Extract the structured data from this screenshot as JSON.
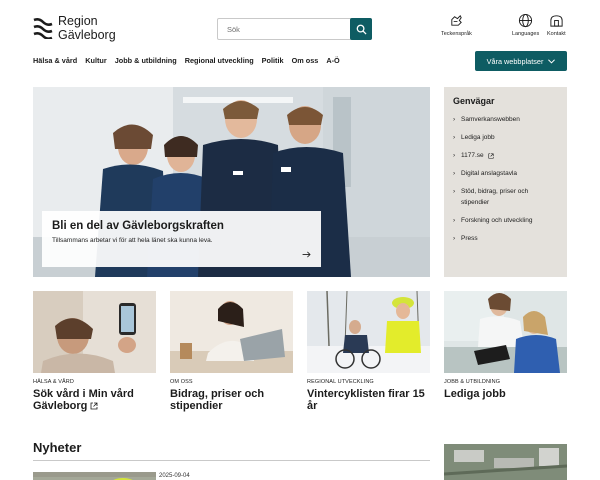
{
  "header": {
    "logo_line1": "Region",
    "logo_line2": "Gävleborg",
    "search_placeholder": "Sök",
    "utilities": [
      {
        "label": "Teckenspråk",
        "icon": "sign-language-icon"
      },
      {
        "label": "Languages",
        "icon": "globe-icon"
      },
      {
        "label": "Kontakt",
        "icon": "contact-icon"
      }
    ]
  },
  "nav": {
    "items": [
      "Hälsa & vård",
      "Kultur",
      "Jobb & utbildning",
      "Regional utveckling",
      "Politik",
      "Om oss",
      "A-Ö"
    ],
    "sites_button": "Våra webbplatser"
  },
  "hero": {
    "title": "Bli en del av Gävleborgskraften",
    "subtitle": "Tillsammans arbetar vi för att hela länet ska kunna leva."
  },
  "shortcuts": {
    "title": "Genvägar",
    "items": [
      {
        "label": "Samverkanswebben",
        "external": false
      },
      {
        "label": "Lediga jobb",
        "external": false
      },
      {
        "label": "1177.se",
        "external": true
      },
      {
        "label": "Digital anslagstavla",
        "external": false
      },
      {
        "label": "Stöd, bidrag, priser och stipendier",
        "external": false
      },
      {
        "label": "Forskning och utveckling",
        "external": false
      },
      {
        "label": "Press",
        "external": false
      }
    ]
  },
  "cards": [
    {
      "category": "HÄLSA & VÅRD",
      "title": "Sök vård i Min vård Gävleborg",
      "external": true
    },
    {
      "category": "OM OSS",
      "title": "Bidrag, priser och stipendier",
      "external": false
    },
    {
      "category": "REGIONAL UTVECKLING",
      "title": "Vintercyklisten firar 15 år",
      "external": false
    },
    {
      "category": "JOBB & UTBILDNING",
      "title": "Lediga jobb",
      "external": false
    }
  ],
  "news": {
    "title": "Nyheter",
    "first_date": "2025-09-04"
  },
  "colors": {
    "accent": "#0e5c63",
    "shortcut_bg": "#e4e1dc"
  }
}
